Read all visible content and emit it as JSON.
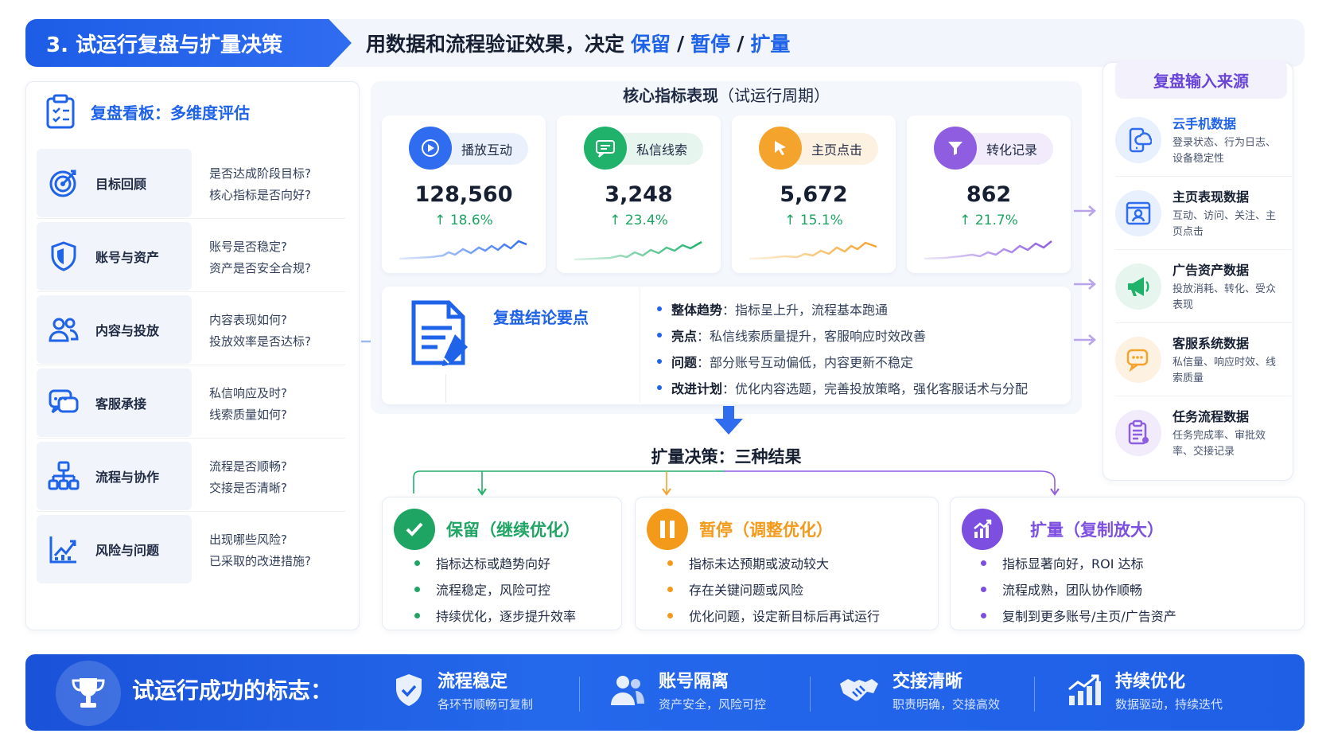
{
  "header": {
    "title": "3. 试运行复盘与扩量决策",
    "subtitle_prefix": "用数据和流程验证效果，决定",
    "keep": "保留",
    "pause": "暂停",
    "expand": "扩量",
    "slash": "/"
  },
  "left_panel": {
    "title": "复盘看板：多维度评估",
    "dimensions": [
      {
        "name": "目标回顾",
        "icon": "target-icon",
        "q1": "是否达成阶段目标?",
        "q2": "核心指标是否向好?"
      },
      {
        "name": "账号与资产",
        "icon": "shield-icon",
        "q1": "账号是否稳定?",
        "q2": "资产是否安全合规?"
      },
      {
        "name": "内容与投放",
        "icon": "users-icon",
        "q1": "内容表现如何?",
        "q2": "投放效率是否达标?"
      },
      {
        "name": "客服承接",
        "icon": "chat-icon",
        "q1": "私信响应及时?",
        "q2": "线索质量如何?"
      },
      {
        "name": "流程与协作",
        "icon": "org-chart-icon",
        "q1": "流程是否顺畅?",
        "q2": "交接是否清晰?"
      },
      {
        "name": "风险与问题",
        "icon": "line-chart-icon",
        "q1": "出现哪些风险?",
        "q2": "已采取的改进措施?"
      }
    ]
  },
  "center": {
    "title_bold": "核心指标表现",
    "title_rest": "（试运行周期）",
    "metrics": [
      {
        "label": "播放互动",
        "value": "128,560",
        "change": "↑ 18.6%",
        "color": "#2f6cf0",
        "icon": "play-icon"
      },
      {
        "label": "私信线索",
        "value": "3,248",
        "change": "↑ 23.4%",
        "color": "#20b16a",
        "icon": "message-icon"
      },
      {
        "label": "主页点击",
        "value": "5,672",
        "change": "↑ 15.1%",
        "color": "#f4a42c",
        "icon": "cursor-icon"
      },
      {
        "label": "转化记录",
        "value": "862",
        "change": "↑ 21.7%",
        "color": "#8f5ee0",
        "icon": "funnel-icon"
      }
    ],
    "conclusion": {
      "title": "复盘结论要点",
      "items": [
        {
          "key": "整体趋势",
          "text": "：指标呈上升，流程基本跑通"
        },
        {
          "key": "亮点",
          "text": "：私信线索质量提升，客服响应时效改善"
        },
        {
          "key": "问题",
          "text": "：部分账号互动偏低，内容更新不稳定"
        },
        {
          "key": "改进计划",
          "text": "：优化内容选题，完善投放策略，强化客服话术与分配"
        }
      ]
    },
    "decision_title": "扩量决策：三种结果",
    "outcomes": [
      {
        "title": "保留（继续优化）",
        "color": "#1ea463",
        "icon": "check-icon",
        "items": [
          "指标达标或趋势向好",
          "流程稳定，风险可控",
          "持续优化，逐步提升效率"
        ]
      },
      {
        "title": "暂停（调整优化）",
        "color": "#f49a1a",
        "icon": "pause-icon",
        "items": [
          "指标未达预期或波动较大",
          "存在关键问题或风险",
          "优化问题，设定新目标后再试运行"
        ]
      },
      {
        "title": "扩量（复制放大）",
        "color": "#7c4fe0",
        "icon": "growth-icon",
        "items": [
          "指标显著向好，ROI 达标",
          "流程成熟，团队协作顺畅",
          "复制到更多账号/主页/广告资产"
        ]
      }
    ]
  },
  "right_panel": {
    "title": "复盘输入来源",
    "sources": [
      {
        "name": "云手机数据",
        "desc": "登录状态、行为日志、设备稳定性",
        "icon": "cloud-phone-icon",
        "color": "#2f6cf0",
        "bg": "#e9f0fd"
      },
      {
        "name": "主页表现数据",
        "desc": "互动、访问、关注、主页点击",
        "icon": "profile-icon",
        "color": "#2f6cf0",
        "bg": "#e9f0fd"
      },
      {
        "name": "广告资产数据",
        "desc": "投放消耗、转化、受众表现",
        "icon": "megaphone-icon",
        "color": "#20b16a",
        "bg": "#e6f6ee"
      },
      {
        "name": "客服系统数据",
        "desc": "私信量、响应时效、线索质量",
        "icon": "support-chat-icon",
        "color": "#f4a42c",
        "bg": "#fdf1e1"
      },
      {
        "name": "任务流程数据",
        "desc": "任务完成率、审批效率、交接记录",
        "icon": "clipboard-icon",
        "color": "#8f5ee0",
        "bg": "#f1ebfc"
      }
    ]
  },
  "footer": {
    "title": "试运行成功的标志：",
    "signs": [
      {
        "name": "流程稳定",
        "desc": "各环节顺畅可复制",
        "icon": "shield-check-icon"
      },
      {
        "name": "账号隔离",
        "desc": "资产安全，风险可控",
        "icon": "team-icon"
      },
      {
        "name": "交接清晰",
        "desc": "职责明确，交接高效",
        "icon": "handshake-icon"
      },
      {
        "name": "持续优化",
        "desc": "数据驱动，持续迭代",
        "icon": "growth-chart-icon"
      }
    ]
  }
}
